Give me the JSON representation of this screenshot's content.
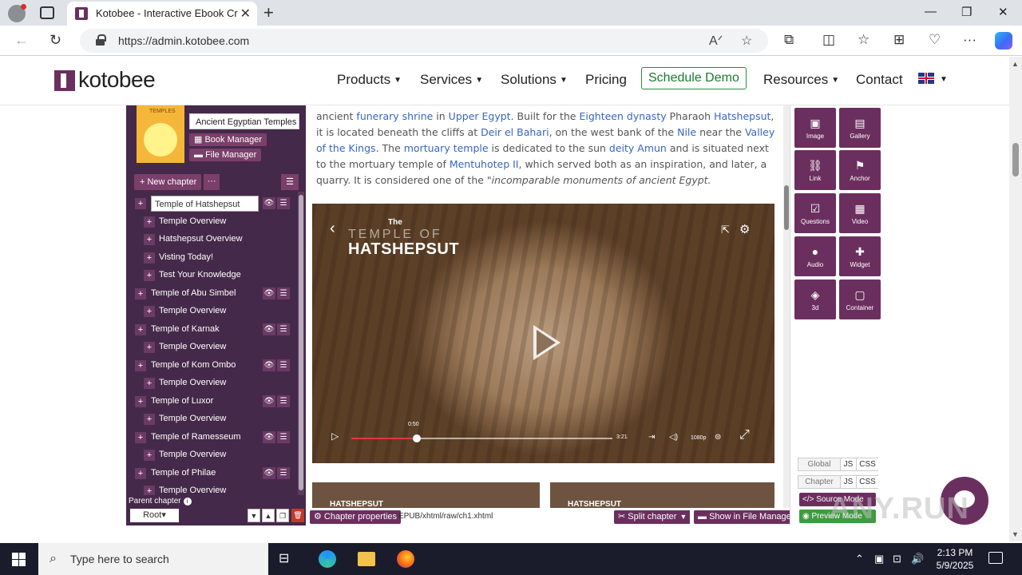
{
  "browser": {
    "tab_title": "Kotobee - Interactive Ebook Crea",
    "url": "https://admin.kotobee.com"
  },
  "site": {
    "logo": "kotobee",
    "nav": [
      "Products",
      "Services",
      "Solutions",
      "Pricing",
      "Schedule Demo",
      "Resources",
      "Contact"
    ],
    "accent": "#6b2f5f"
  },
  "sidebar": {
    "cover_label": "TEMPLES",
    "book_title": "Ancient Egyptian Temples",
    "book_manager": "Book Manager",
    "file_manager": "File Manager",
    "new_chapter": "New chapter",
    "chapters": [
      {
        "label": "Temple of Hatshepsut",
        "sub": [
          "Temple Overview",
          "Hatshepsut Overview",
          "Visting Today!",
          "Test Your Knowledge"
        ]
      },
      {
        "label": "Temple of Abu Simbel",
        "sub": [
          "Temple Overview"
        ]
      },
      {
        "label": "Temple of Karnak",
        "sub": [
          "Temple Overview"
        ]
      },
      {
        "label": "Temple of Kom Ombo",
        "sub": [
          "Temple Overview"
        ]
      },
      {
        "label": "Temple of Luxor",
        "sub": [
          "Temple Overview"
        ]
      },
      {
        "label": "Temple of Ramesseum",
        "sub": [
          "Temple Overview"
        ]
      },
      {
        "label": "Temple of Philae",
        "sub": [
          "Temple Overview"
        ]
      }
    ],
    "parent_chapter": "Parent chapter",
    "root": "Root"
  },
  "content": {
    "p1": "ancient ",
    "l1": "funerary shrine",
    "p2": " in ",
    "l2": "Upper Egypt",
    "p3": ". Built for the ",
    "l3": "Eighteen dynasty",
    "p4": " Pharaoh ",
    "l4": "Hatshepsut",
    "p5": ", it is located beneath the cliffs at ",
    "l5": "Deir el Bahari",
    "p6": ", on the west bank of the ",
    "l6": "Nile",
    "p7": " near the ",
    "l7": "Valley of the Kings",
    "p8": ". The ",
    "l8": "mortuary temple",
    "p9": " is dedicated to the sun ",
    "l9": "deity Amun",
    "p10": " and is situated next to the mortuary temple of ",
    "l10": "Mentuhotep II",
    "p11": ", which served both as an inspiration, and later, a quarry. It is considered one of the \"",
    "em1": "incomparable monuments of ancient Egypt.",
    "video": {
      "title_small": "The",
      "title_mid": "TEMPLE OF",
      "title_big": "HATSHEPSUT",
      "current_time": "0:50",
      "duration": "3:21",
      "quality": "1080p",
      "progress": 0.25
    },
    "thumb_title": "HATSHEPSUT"
  },
  "bottombar": {
    "chapter_properties": "Chapter properties",
    "path": "EPUB/xhtml/raw/ch1.xhtml",
    "split_chapter": "Split chapter",
    "show_in_file_manager": "Show in File Manager"
  },
  "tools": [
    "Image",
    "Gallery",
    "Link",
    "Anchor",
    "Questions",
    "Video",
    "Audio",
    "Widget",
    "3d",
    "Container"
  ],
  "scopes": {
    "global": "Global",
    "chapter": "Chapter",
    "js": "JS",
    "css": "CSS"
  },
  "source_mode": "Source Mode",
  "preview_mode": "Preview Mode",
  "watermark": "ANY.RUN",
  "taskbar": {
    "search_placeholder": "Type here to search",
    "time": "2:13 PM",
    "date": "5/9/2025"
  }
}
